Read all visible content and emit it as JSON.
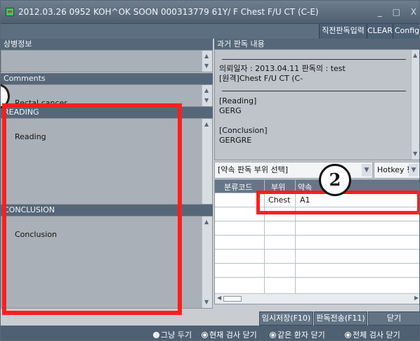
{
  "window": {
    "title": "2012.03.26 0952 KOH^OK SOON 000313779 61Y/ F Chest F/U CT (C-E)",
    "controls": [
      "_",
      "□",
      "X"
    ]
  },
  "toolbar": {
    "buttons": [
      "직전판독입력",
      "CLEAR",
      "Config"
    ]
  },
  "left": {
    "sang_title": "상병정보",
    "comments_title": "Comments",
    "comments_value": "Rectal cancer",
    "reading_title": "READING",
    "reading_value": "Reading",
    "conclusion_title": "CONCLUSION",
    "conclusion_value": "Conclusion"
  },
  "history": {
    "title": "과거 판독 내용",
    "lines": [
      "의뢰일자 : 2013.04.11 판독의 : test",
      "[원격]Chest F/U CT (C-",
      "[Reading]",
      "GERG",
      "[Conclusion]",
      "GERGRE"
    ]
  },
  "selectors": {
    "shortcut_value": "[약속 판독 부위 선택]",
    "hotkey_value": "Hotkey 편"
  },
  "grid": {
    "headers": [
      "분류코드",
      "부위",
      "약속"
    ],
    "rows": [
      [
        "",
        "Chest",
        "A1"
      ],
      [
        "",
        "",
        ""
      ]
    ]
  },
  "buttons": {
    "temp_save": "임시저장(F10)",
    "send": "판독전송(F11)",
    "close": "닫기"
  },
  "radio_options": [
    {
      "label": "그냥 두기",
      "checked": false
    },
    {
      "label": "현재 검사 닫기",
      "checked": true
    },
    {
      "label": "같은 환자 닫기",
      "checked": true
    },
    {
      "label": "전체 검사 닫기",
      "checked": true
    }
  ],
  "callouts": {
    "grid_callout": "2"
  },
  "colors": {
    "highlight": "#ff1e1e",
    "panel_header": "#566779",
    "text_area": "#aab0b7"
  }
}
